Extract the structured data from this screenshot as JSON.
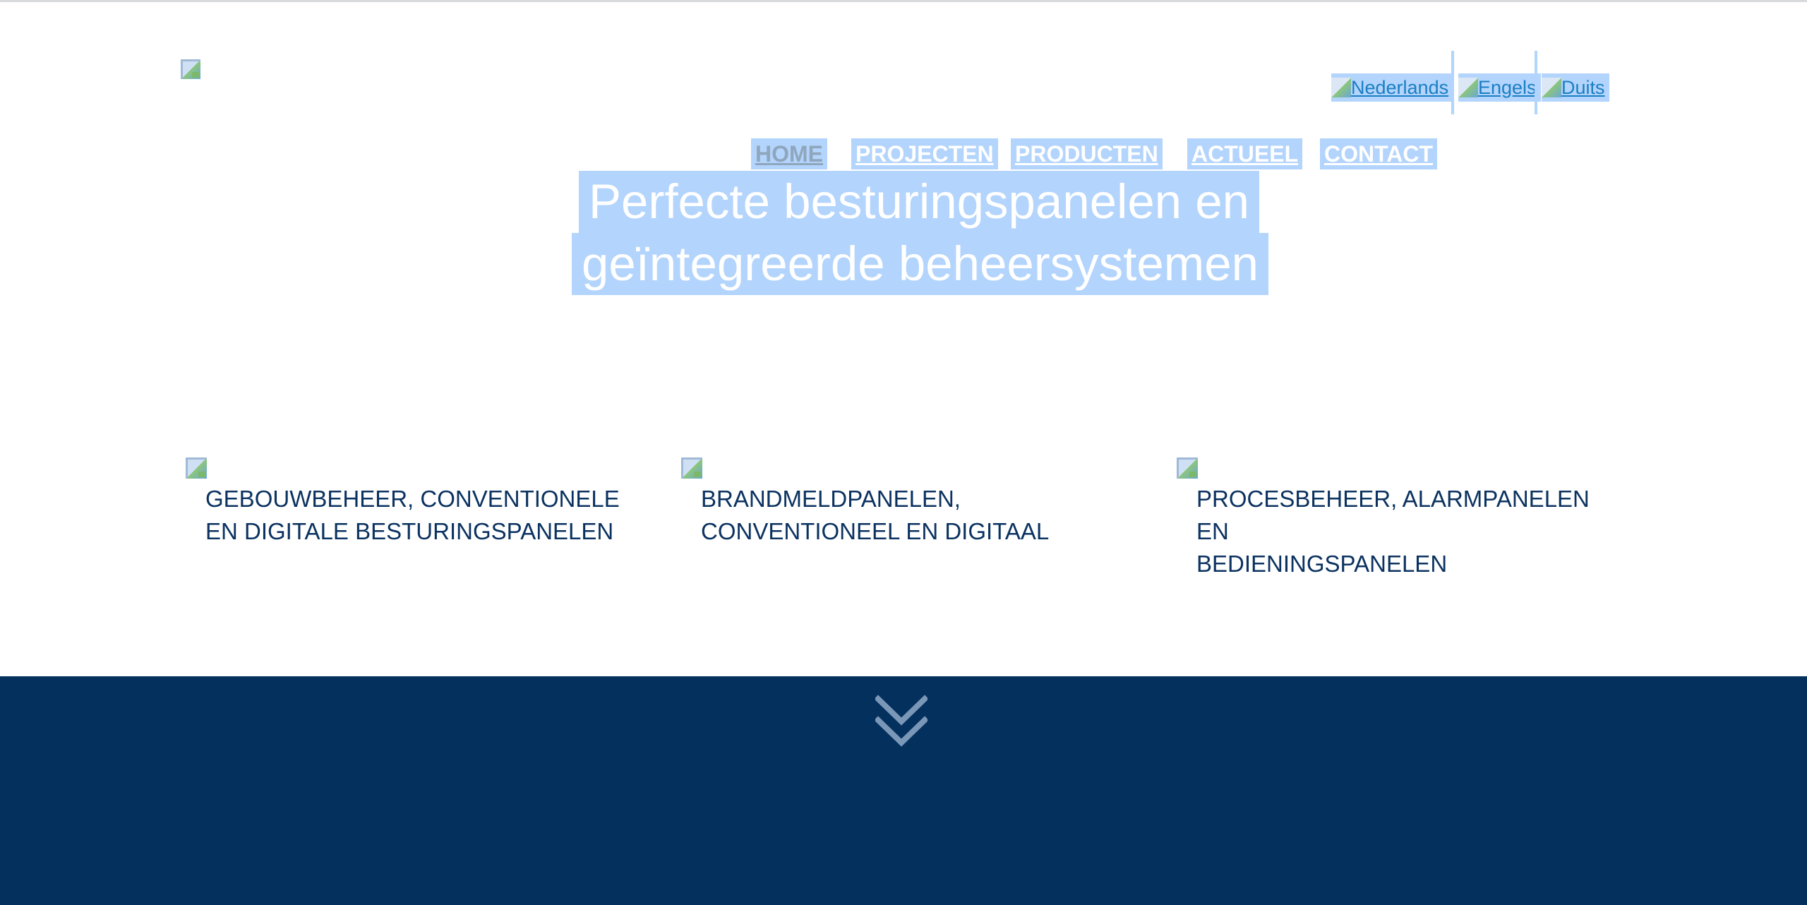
{
  "brand": {
    "logo_icon": "broken-image-icon"
  },
  "languages": [
    {
      "label": "Nederlands",
      "icon": "broken-image-icon"
    },
    {
      "label": "Engels",
      "icon": "broken-image-icon"
    },
    {
      "label": "Duits",
      "icon": "broken-image-icon"
    }
  ],
  "nav": [
    {
      "label": "HOME",
      "active": true
    },
    {
      "label": "PROJECTEN"
    },
    {
      "label": "PRODUCTEN"
    },
    {
      "label": "ACTUEEL"
    },
    {
      "label": "CONTACT"
    }
  ],
  "hero": {
    "line1": "Perfecte besturingspanelen en",
    "line2": "geïntegreerde beheersystemen"
  },
  "features": [
    {
      "line1": "GEBOUWBEHEER, CONVENTIONELE",
      "line2": "EN DIGITALE BESTURINGSPANELEN"
    },
    {
      "line1": "BRANDMELDPANELEN,",
      "line2": "CONVENTIONEEL EN DIGITAAL"
    },
    {
      "line1": "PROCESBEHEER, ALARMPANELEN EN",
      "line2": "BEDIENINGSPANELEN"
    }
  ],
  "footer": {
    "scroll_icon": "double-chevron-down-icon"
  },
  "colors": {
    "selection": "#b3d4fc",
    "link": "#1a7fc2",
    "navy": "#04305e",
    "feature_text": "#0b3260",
    "nav_active": "#8fa6bd"
  }
}
